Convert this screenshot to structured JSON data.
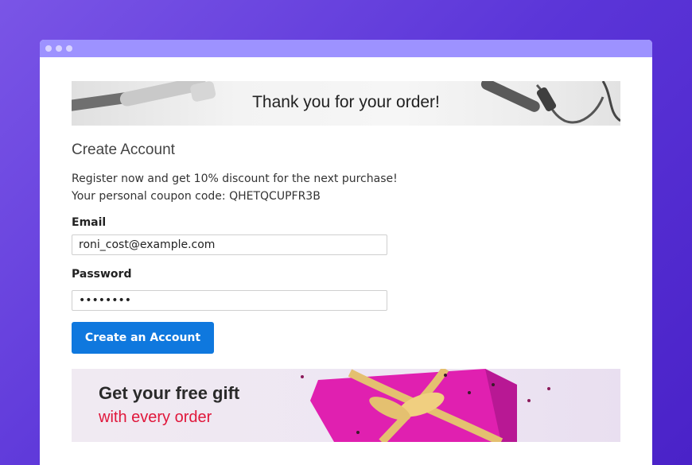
{
  "banner_top": {
    "text": "Thank you for your order!"
  },
  "section": {
    "title": "Create Account"
  },
  "promo": {
    "line1": "Register now and get 10% discount for the next purchase!",
    "line2": "Your personal coupon code: QHETQCUPFR3B"
  },
  "form": {
    "email_label": "Email",
    "email_value": "roni_cost@example.com",
    "password_label": "Password",
    "password_value": "••••••••",
    "submit_label": "Create an Account"
  },
  "banner_bottom": {
    "line1": "Get your free gift",
    "line2": "with every order"
  },
  "colors": {
    "background": "#5b35d8",
    "titlebar": "#9d92ff",
    "button": "#0f78de",
    "gift_accent": "#e0173b",
    "gift_box": "#e020b0"
  },
  "icons": [
    "window-dot-icon",
    "window-dot-icon",
    "window-dot-icon"
  ]
}
